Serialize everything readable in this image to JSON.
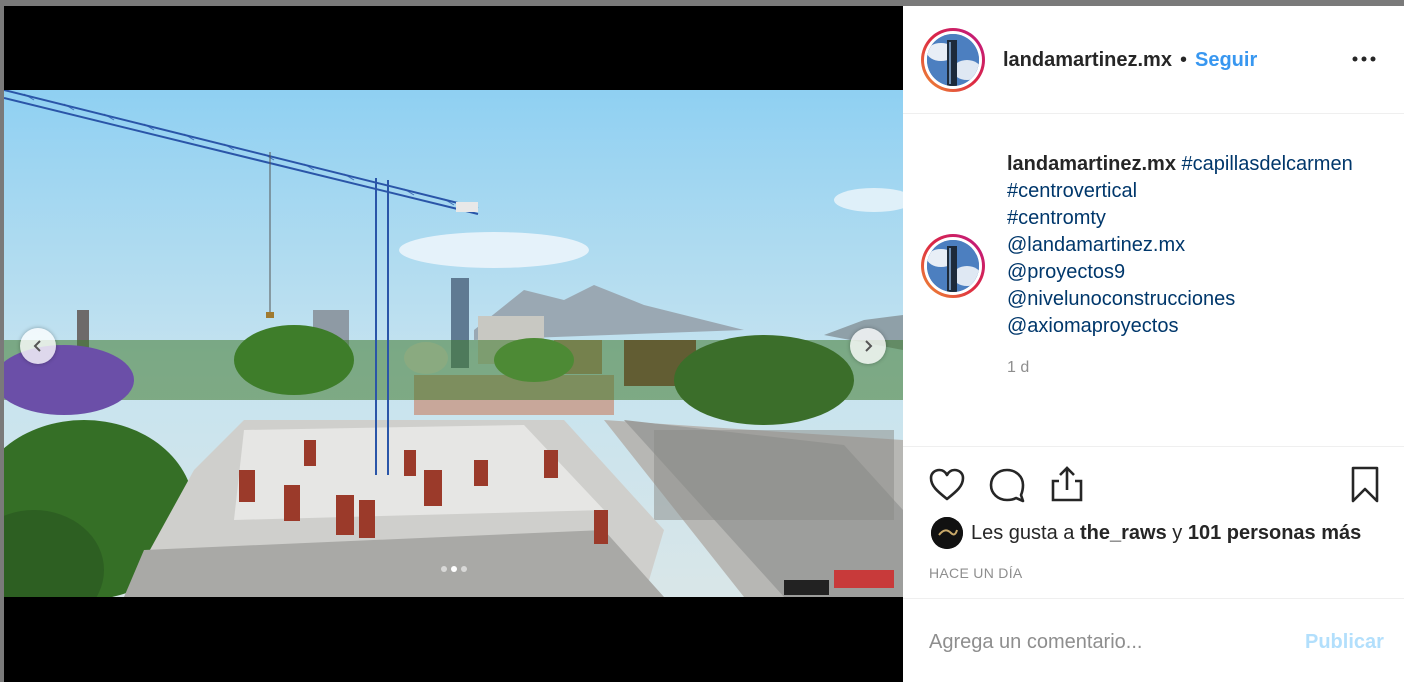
{
  "post": {
    "username": "landamartinez.mx",
    "separator": "•",
    "follow_label": "Seguir",
    "more_icon": "more-options-icon",
    "caption": {
      "username": "landamartinez.mx",
      "lines": [
        "#capillasdelcarmen",
        "#centrovertical",
        "#centromty",
        "@landamartinez.mx",
        "@proyectos9",
        "@niveluno​construcciones",
        "@axiomaproyectos"
      ]
    },
    "time": "1 d",
    "likes": {
      "prefix": "Les gusta a",
      "user": "the_raws",
      "joiner": "y",
      "others": "101 personas más"
    },
    "ago": "HACE UN DÍA",
    "comment_placeholder": "Agrega un comentario...",
    "publish_label": "Publicar",
    "carousel": {
      "slide_count": 3,
      "active_slide": 2
    },
    "colors": {
      "link": "#00376b",
      "follow": "#3897f0",
      "publish_disabled": "#b2dffc"
    }
  }
}
